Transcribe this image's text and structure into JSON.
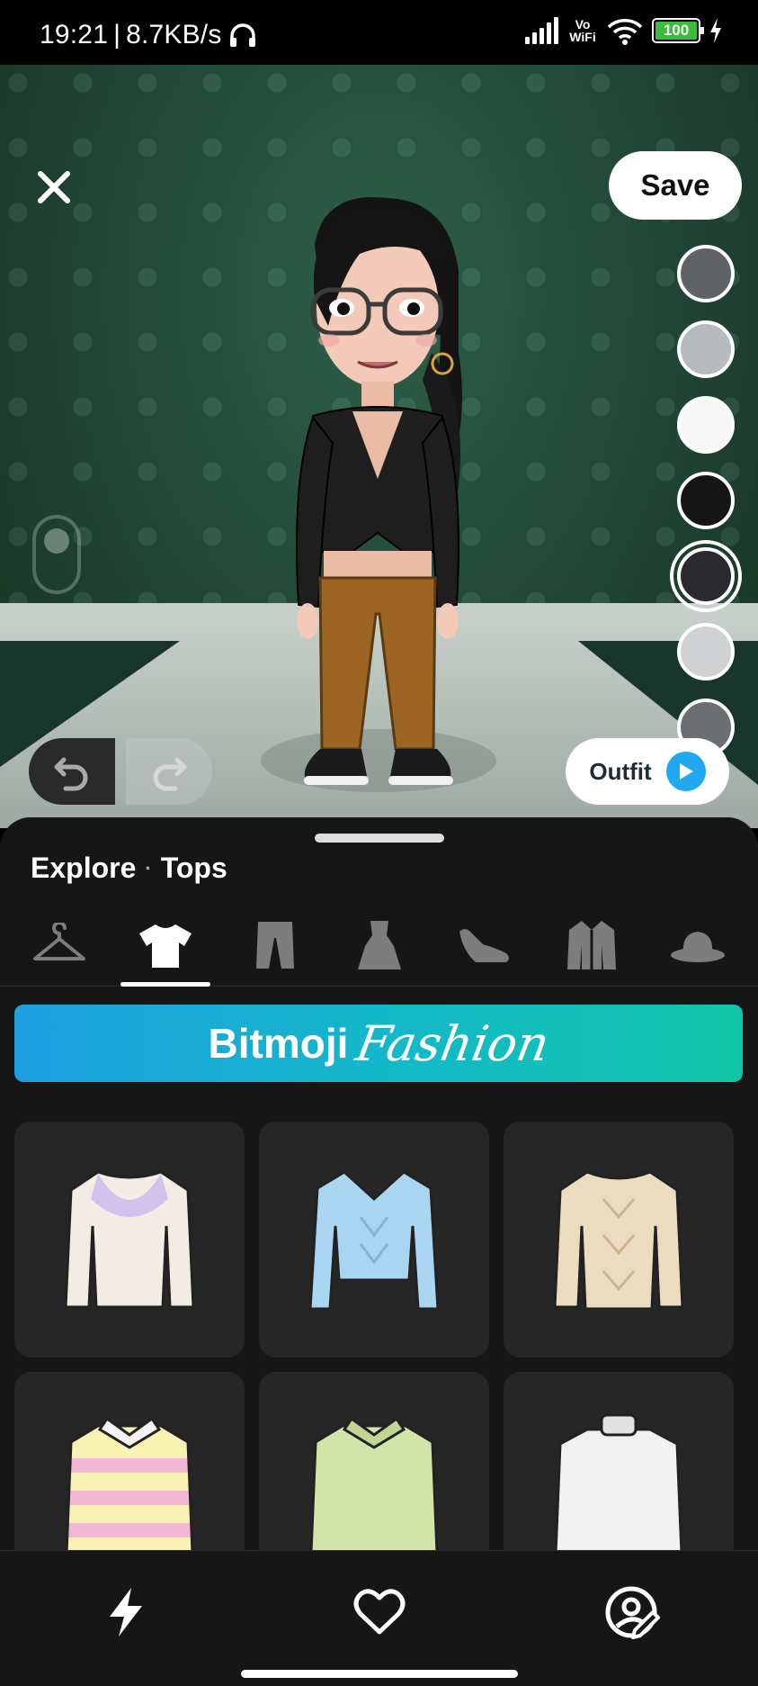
{
  "status_bar": {
    "time": "19:21",
    "separator": "|",
    "net_speed": "8.7KB/s",
    "vowifi": "Vo WiFi",
    "battery": "100"
  },
  "top": {
    "save_label": "Save",
    "outfit_label": "Outfit"
  },
  "swatches": [
    "#606366",
    "#b7bbbe",
    "#f6f6f6",
    "#151515",
    "#2a292d",
    "#cfd1d3",
    "#6c6f71"
  ],
  "panel": {
    "breadcrumb_1": "Explore",
    "breadcrumb_dot": "·",
    "breadcrumb_2": "Tops",
    "categories": [
      "hanger-icon",
      "tshirt-icon",
      "pants-icon",
      "dress-icon",
      "shoe-icon",
      "jacket-icon",
      "hat-icon"
    ],
    "active_category": "tshirt-icon",
    "banner_word_1": "Bitmoji",
    "banner_word_2": "Fashion"
  },
  "items": [
    {
      "name": "fair-isle-sweater",
      "body": "#f2ede4",
      "accent": "#b9a6e6"
    },
    {
      "name": "blue-cable-knit-crop-sweater",
      "body": "#a9d5f0",
      "accent": "#8fc3e5"
    },
    {
      "name": "beige-cable-knit-sweater",
      "body": "#ecdcbf",
      "accent": "#d7c6a4"
    },
    {
      "name": "pink-yellow-striped-polo",
      "body": "#f9f3b3",
      "accent": "#f2b6d6"
    },
    {
      "name": "green-polo-sweater",
      "body": "#d3e4a8",
      "accent": "#bcd08e"
    },
    {
      "name": "white-turtleneck",
      "body": "#f1f1f1",
      "accent": "#dcdcdc"
    }
  ],
  "bottom_nav": [
    "bolt-icon",
    "heart-icon",
    "avatar-edit-icon"
  ]
}
